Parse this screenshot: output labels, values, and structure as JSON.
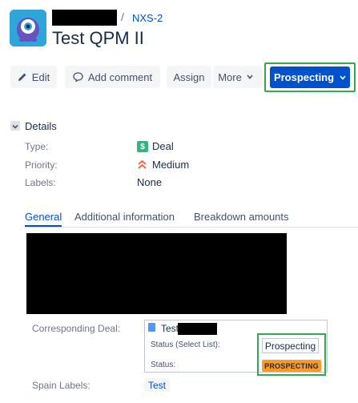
{
  "header": {
    "breadcrumb_separator": "/",
    "issue_key": "NXS-2",
    "title": "Test QPM II"
  },
  "toolbar": {
    "edit_label": "Edit",
    "comment_label": "Add comment",
    "assign_label": "Assign",
    "more_label": "More",
    "status_label": "Prospecting"
  },
  "details": {
    "section_title": "Details",
    "fields": [
      {
        "label": "Type:",
        "value": "Deal"
      },
      {
        "label": "Priority:",
        "value": "Medium"
      },
      {
        "label": "Labels:",
        "value": "None"
      }
    ]
  },
  "tabs": [
    {
      "label": "General"
    },
    {
      "label": "Additional information"
    },
    {
      "label": "Breakdown amounts"
    }
  ],
  "corresponding_deal": {
    "label": "Corresponding Deal:",
    "deal_name": "Test",
    "status_select_label": "Status (Select List):",
    "status_select_value": "Prospecting",
    "status_label": "Status:",
    "status_value": "PROSPECTING"
  },
  "spain_labels": {
    "label": "Spain Labels:",
    "value": "Test"
  },
  "colors": {
    "primary": "#0052cc",
    "highlight_border": "#33a852",
    "status_lozenge": "#ff991f",
    "deal_icon": "#36b37e",
    "priority_icon": "#ff5630"
  },
  "icons": {
    "edit": "pencil-icon",
    "comment": "comment-icon",
    "more": "chevron-down-icon",
    "type": "dollar-icon",
    "priority": "double-chevron-up-icon"
  }
}
